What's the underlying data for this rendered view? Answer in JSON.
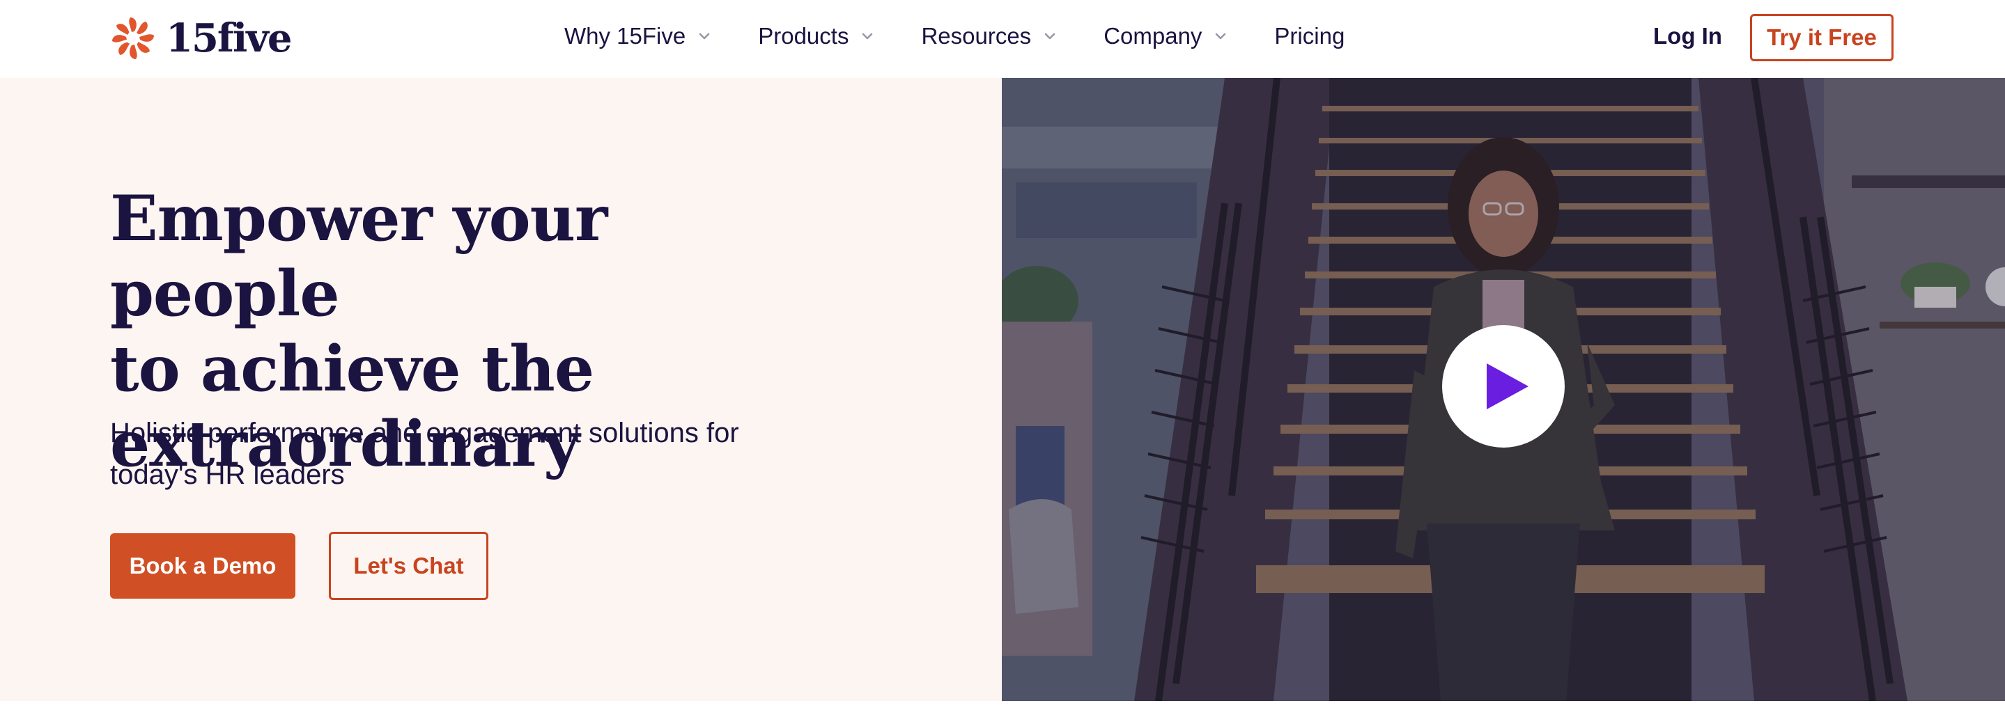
{
  "brand": {
    "name": "15five",
    "accent": "#e1562c",
    "primary_text": "#1b1340",
    "button_color": "#d14f24",
    "hero_bg": "#fdf5f1",
    "play_color": "#6a1ee0"
  },
  "nav": {
    "items": [
      {
        "label": "Why 15Five",
        "has_dropdown": true
      },
      {
        "label": "Products",
        "has_dropdown": true
      },
      {
        "label": "Resources",
        "has_dropdown": true
      },
      {
        "label": "Company",
        "has_dropdown": true
      },
      {
        "label": "Pricing",
        "has_dropdown": false
      }
    ],
    "login_label": "Log In",
    "cta_label": "Try it Free"
  },
  "hero": {
    "headline_lines": [
      "Empower your people",
      "to achieve the",
      "extraordinary"
    ],
    "subhead_lines": [
      "Holistic performance and engagement solutions for",
      "today's HR leaders"
    ],
    "primary_cta": "Book a Demo",
    "secondary_cta": "Let's Chat"
  },
  "video": {
    "play_icon": "play-icon",
    "chevron_icon": "chevron-down-icon"
  }
}
